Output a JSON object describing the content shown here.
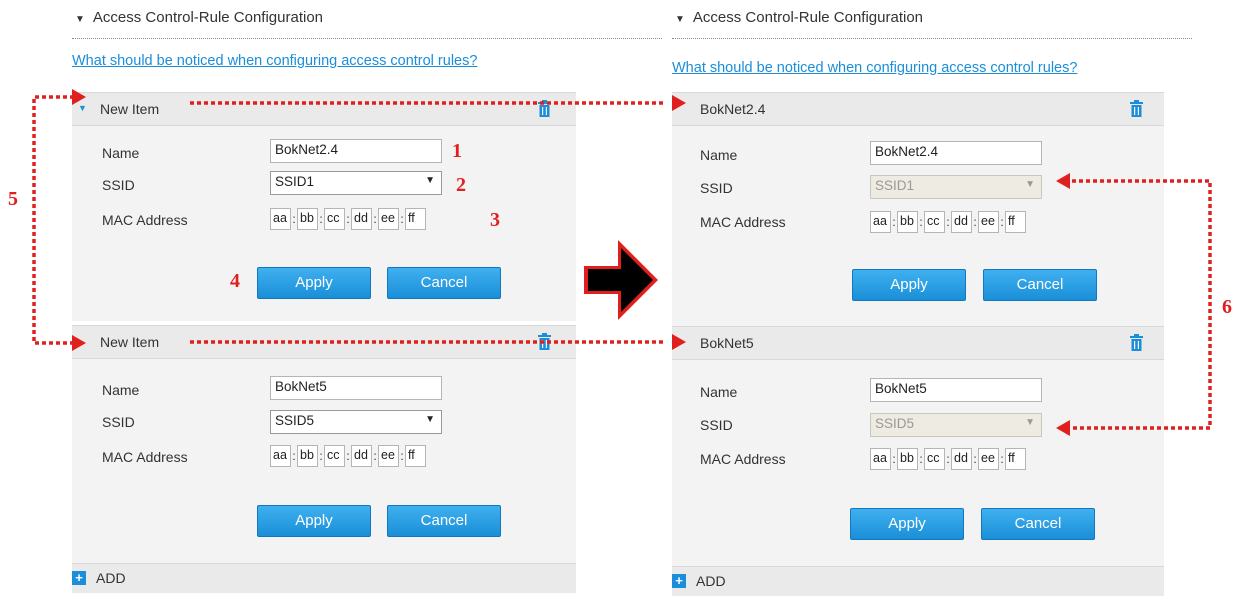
{
  "left": {
    "section_title": "Access Control-Rule Configuration",
    "help_link": "What should be noticed when configuring access control rules?",
    "items": [
      {
        "header": "New Item",
        "name_label": "Name",
        "name_value": "BokNet2.4",
        "ssid_label": "SSID",
        "ssid_value": "SSID1",
        "mac_label": "MAC Address",
        "mac": [
          "aa",
          "bb",
          "cc",
          "dd",
          "ee",
          "ff"
        ],
        "apply": "Apply",
        "cancel": "Cancel"
      },
      {
        "header": "New Item",
        "name_label": "Name",
        "name_value": "BokNet5",
        "ssid_label": "SSID",
        "ssid_value": "SSID5",
        "mac_label": "MAC Address",
        "mac": [
          "aa",
          "bb",
          "cc",
          "dd",
          "ee",
          "ff"
        ],
        "apply": "Apply",
        "cancel": "Cancel"
      }
    ],
    "add_label": "ADD"
  },
  "right": {
    "section_title": "Access Control-Rule Configuration",
    "help_link": "What should be noticed when configuring access control rules?",
    "items": [
      {
        "header": "BokNet2.4",
        "name_label": "Name",
        "name_value": "BokNet2.4",
        "ssid_label": "SSID",
        "ssid_value": "SSID1",
        "mac_label": "MAC Address",
        "mac": [
          "aa",
          "bb",
          "cc",
          "dd",
          "ee",
          "ff"
        ],
        "apply": "Apply",
        "cancel": "Cancel"
      },
      {
        "header": "BokNet5",
        "name_label": "Name",
        "name_value": "BokNet5",
        "ssid_label": "SSID",
        "ssid_value": "SSID5",
        "mac_label": "MAC Address",
        "mac": [
          "aa",
          "bb",
          "cc",
          "dd",
          "ee",
          "ff"
        ],
        "apply": "Apply",
        "cancel": "Cancel"
      }
    ],
    "add_label": "ADD"
  },
  "annotations": {
    "n1": "1",
    "n2": "2",
    "n3": "3",
    "n4": "4",
    "n5": "5",
    "n6": "6"
  },
  "colors": {
    "accent": "#1a8ed8",
    "annotation": "#e0201e",
    "ssid_disabled_bg": "#eeebe2"
  },
  "icons": {
    "collapse": "triangle-down-icon",
    "trash": "trash-icon",
    "add": "plus-icon",
    "flow_arrow": "big-right-arrow-icon"
  }
}
